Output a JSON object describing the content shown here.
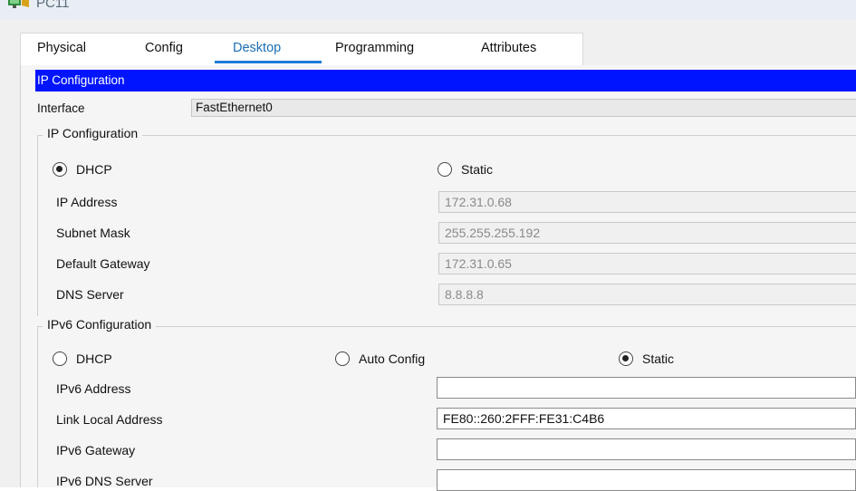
{
  "window": {
    "title": "PC11"
  },
  "tabs": [
    {
      "label": "Physical"
    },
    {
      "label": "Config"
    },
    {
      "label": "Desktop"
    },
    {
      "label": "Programming"
    },
    {
      "label": "Attributes"
    }
  ],
  "panel": {
    "header": "IP Configuration",
    "interface_label": "Interface",
    "interface_value": "FastEthernet0"
  },
  "ipv4": {
    "group_title": "IP Configuration",
    "dhcp_label": "DHCP",
    "static_label": "Static",
    "mode": "DHCP",
    "ip_address_label": "IP Address",
    "ip_address": "172.31.0.68",
    "subnet_mask_label": "Subnet Mask",
    "subnet_mask": "255.255.255.192",
    "default_gateway_label": "Default Gateway",
    "default_gateway": "172.31.0.65",
    "dns_server_label": "DNS Server",
    "dns_server": "8.8.8.8"
  },
  "ipv6": {
    "group_title": "IPv6 Configuration",
    "dhcp_label": "DHCP",
    "auto_label": "Auto Config",
    "static_label": "Static",
    "mode": "Static",
    "ipv6_address_label": "IPv6 Address",
    "ipv6_address": "",
    "link_local_label": "Link Local Address",
    "link_local": "FE80::260:2FFF:FE31:C4B6",
    "gateway_label": "IPv6 Gateway",
    "gateway": "",
    "dns_label": "IPv6 DNS Server",
    "dns": ""
  },
  "colors": {
    "header_bg": "#0014ff",
    "active_tab": "#1a6fb5",
    "tab_underline": "#1e7bd7"
  }
}
